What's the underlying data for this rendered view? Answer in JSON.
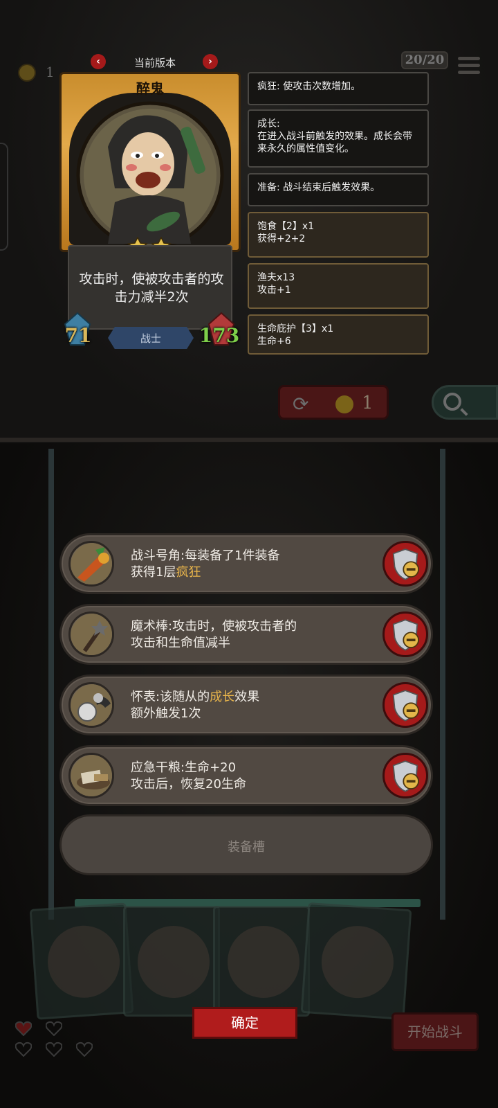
{
  "hud": {
    "coin_count": "1",
    "counter": "20/20",
    "reroll_cost": "1"
  },
  "version": {
    "label": "当前版本"
  },
  "hero": {
    "name": "醉鬼",
    "stars": 2,
    "ability": "攻击时，使被攻击者的攻击力减半2次",
    "attack": "71",
    "health": "173",
    "class": "战士"
  },
  "tooltips": [
    {
      "text": "疯狂: 使攻击次数增加。"
    },
    {
      "text": "成长:\n在进入战斗前触发的效果。成长会带来永久的属性值变化。"
    },
    {
      "text": "准备: 战斗结束后触发效果。"
    },
    {
      "text": "饱食【2】x1\n获得+2+2"
    },
    {
      "text": "渔夫x13\n攻击+1"
    },
    {
      "text": "生命庇护【3】x1\n生命+6"
    }
  ],
  "equipment": [
    {
      "text_before": "战斗号角:每装备了1件装备\n获得1层",
      "keyword": "疯狂",
      "text_after": ""
    },
    {
      "text_before": "魔术棒:攻击时，使被攻击者的\n攻击和生命值减半",
      "keyword": "",
      "text_after": ""
    },
    {
      "text_before": "怀表:该随从的",
      "keyword": "成长",
      "text_after": "效果\n额外触发1次"
    },
    {
      "text_before": "应急干粮:生命+20\n攻击后，恢复20生命",
      "keyword": "",
      "text_after": ""
    }
  ],
  "slot_label": "装备槽",
  "buttons": {
    "confirm": "确定",
    "start_battle": "开始战斗"
  },
  "colors": {
    "accent_red": "#a51a1a",
    "keyword_gold": "#e7b44b",
    "health_green": "#7ecf4a",
    "attack_gold": "#d8b75a"
  }
}
